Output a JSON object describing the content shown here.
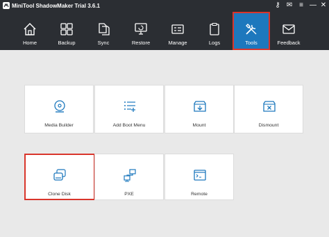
{
  "window": {
    "title": "MiniTool ShadowMaker Trial 3.6.1",
    "controls": [
      {
        "name": "key-icon",
        "glyph": "⚷"
      },
      {
        "name": "mail-icon",
        "glyph": "✉"
      },
      {
        "name": "menu-icon",
        "glyph": "≡"
      },
      {
        "name": "minimize-icon",
        "glyph": "—"
      },
      {
        "name": "close-icon",
        "glyph": "✕"
      }
    ]
  },
  "nav": {
    "active": "Tools",
    "accent_color": "#1d78bd",
    "highlight_color": "#d9352b",
    "items": [
      {
        "label": "Home",
        "icon": "home-icon"
      },
      {
        "label": "Backup",
        "icon": "backup-icon"
      },
      {
        "label": "Sync",
        "icon": "sync-icon"
      },
      {
        "label": "Restore",
        "icon": "restore-icon"
      },
      {
        "label": "Manage",
        "icon": "manage-icon"
      },
      {
        "label": "Logs",
        "icon": "logs-icon"
      },
      {
        "label": "Tools",
        "icon": "tools-icon"
      },
      {
        "label": "Feedback",
        "icon": "feedback-icon"
      }
    ]
  },
  "tools": [
    {
      "label": "Media Builder",
      "icon": "media-builder-icon"
    },
    {
      "label": "Add Boot Menu",
      "icon": "add-boot-menu-icon"
    },
    {
      "label": "Mount",
      "icon": "mount-icon"
    },
    {
      "label": "Dismount",
      "icon": "dismount-icon"
    },
    {
      "label": "Clone Disk",
      "icon": "clone-disk-icon",
      "selected": true
    },
    {
      "label": "PXE",
      "icon": "pxe-icon"
    },
    {
      "label": "Remote",
      "icon": "remote-icon"
    }
  ]
}
